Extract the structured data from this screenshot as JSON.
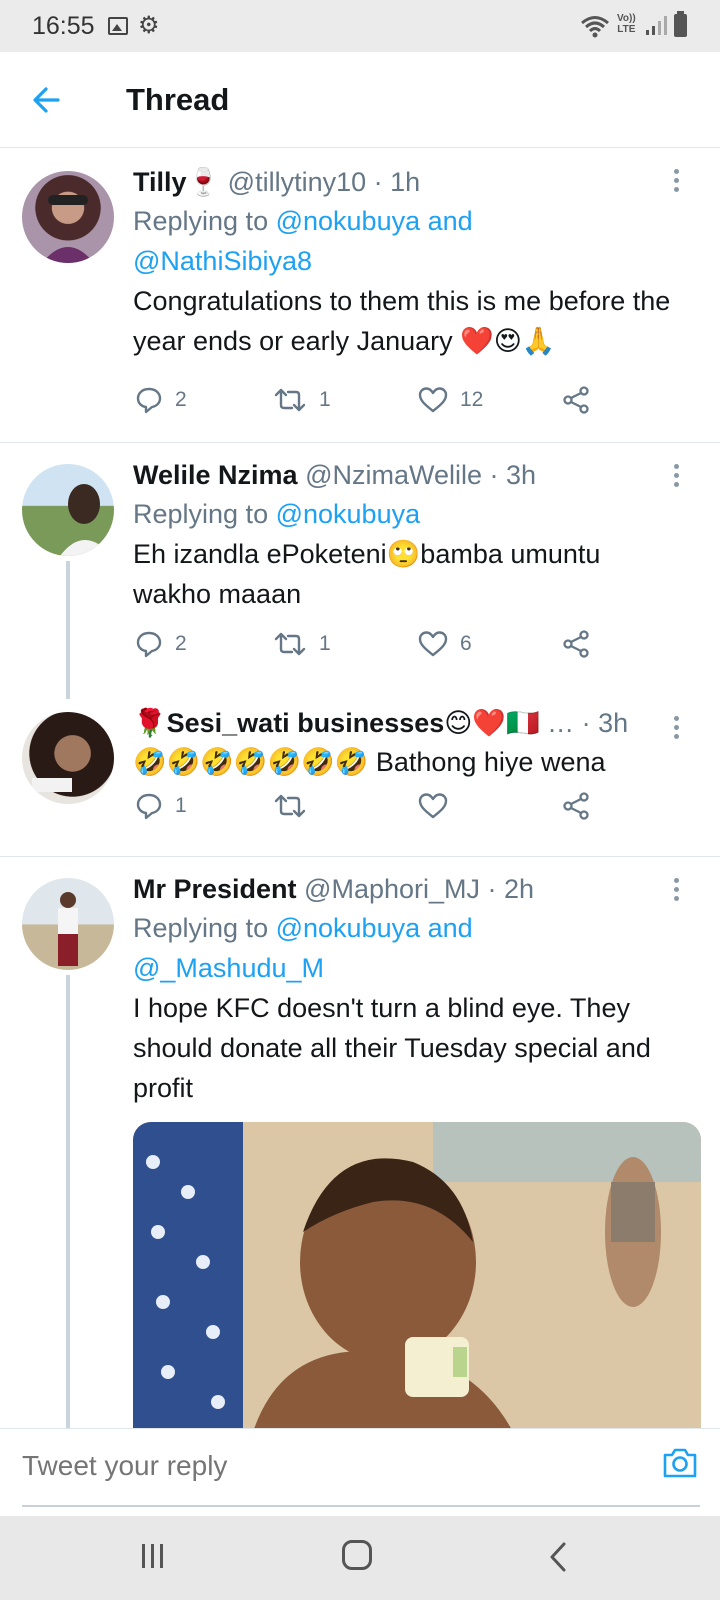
{
  "status_bar": {
    "time": "16:55",
    "volte_line1": "Vo))",
    "volte_line2": "LTE"
  },
  "header": {
    "title": "Thread"
  },
  "colors": {
    "link": "#1da1f2",
    "meta": "#657786",
    "text": "#14171a",
    "heart": "#e0245e"
  },
  "tweets": [
    {
      "name": "Tilly🍷",
      "meta": " @tillytiny10 · 1h",
      "replying_prefix": "Replying to ",
      "replying_to_1": "@nokubuya and",
      "replying_to_2": "@NathiSibiya8",
      "text": "Congratulations to them this is me before the year ends or early January ❤️😍🙏",
      "replies": "2",
      "retweets": "1",
      "likes": "12"
    },
    {
      "name": "Welile Nzima",
      "meta": " @NzimaWelile · 3h",
      "replying_prefix": "Replying to ",
      "replying_to_1": "@nokubuya",
      "text": "Eh izandla ePoketeni🙄bamba umuntu wakho maaan",
      "replies": "2",
      "retweets": "1",
      "likes": "6"
    },
    {
      "name": "🌹Sesi_wati businesses😊❤️🇮🇹",
      "meta": " … · 3h",
      "text": "🤣🤣🤣🤣🤣🤣🤣 Bathong  hiye wena",
      "replies": "1",
      "retweets": "",
      "likes": ""
    },
    {
      "name": "Mr President",
      "meta": " @Maphori_MJ · 2h",
      "replying_prefix": "Replying to ",
      "replying_to_1": "@nokubuya and",
      "replying_to_2": "@_Mashudu_M",
      "text": "I hope KFC doesn't turn a blind eye. They should donate all their Tuesday special and profit"
    }
  ],
  "reply_bar": {
    "placeholder": "Tweet your reply"
  },
  "icons": {
    "back": "arrow-left-icon",
    "more": "more-vertical-icon",
    "reply": "comment-icon",
    "retweet": "retweet-icon",
    "like": "heart-icon",
    "share": "share-icon",
    "camera": "camera-icon"
  }
}
